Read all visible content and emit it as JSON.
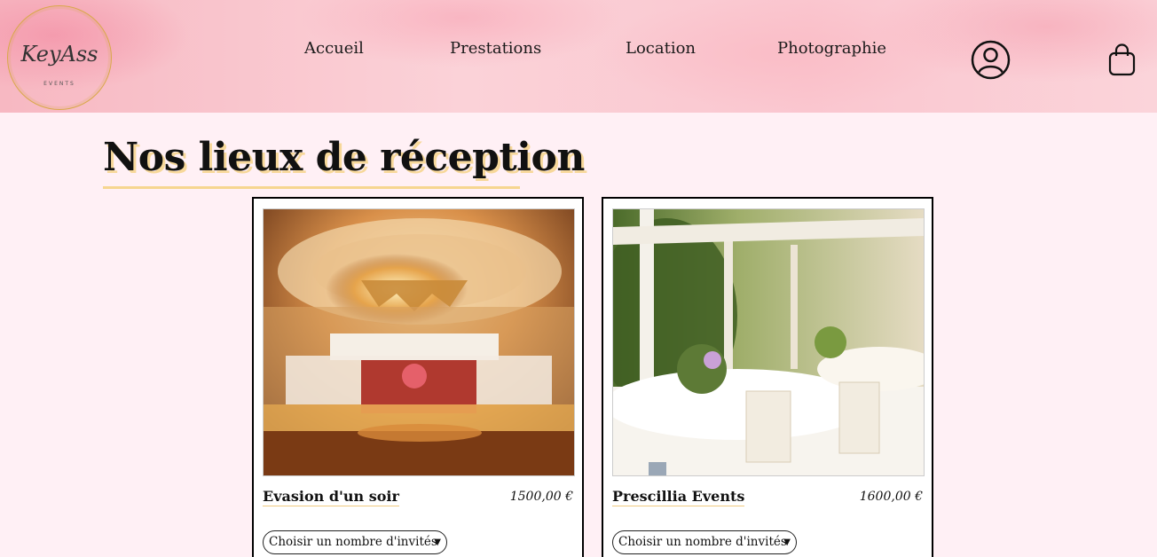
{
  "logo": {
    "mark": "KeyAss",
    "subtitle": "EVENTS"
  },
  "nav": {
    "items": [
      {
        "label": "Accueil"
      },
      {
        "label": "Prestations"
      },
      {
        "label": "Location"
      },
      {
        "label": "Photographie"
      }
    ],
    "icons": [
      "user-account-icon",
      "shopping-bag-icon"
    ]
  },
  "page": {
    "title": "Nos lieux de réception"
  },
  "venues": [
    {
      "name": "Evasion d'un soir",
      "price": "1500,00 €",
      "select_placeholder": "Choisir un nombre d'invités",
      "image": "indian-wedding-hall-chandelier"
    },
    {
      "name": "Prescillia Events",
      "price": "1600,00 €",
      "select_placeholder": "Choisir un nombre d'invités",
      "image": "outdoor-garden-reception-tables"
    }
  ],
  "colors": {
    "background": "#fff0f5",
    "header_pink": "#f7b8c2",
    "accent_gold": "#f6d690",
    "text": "#111111"
  }
}
